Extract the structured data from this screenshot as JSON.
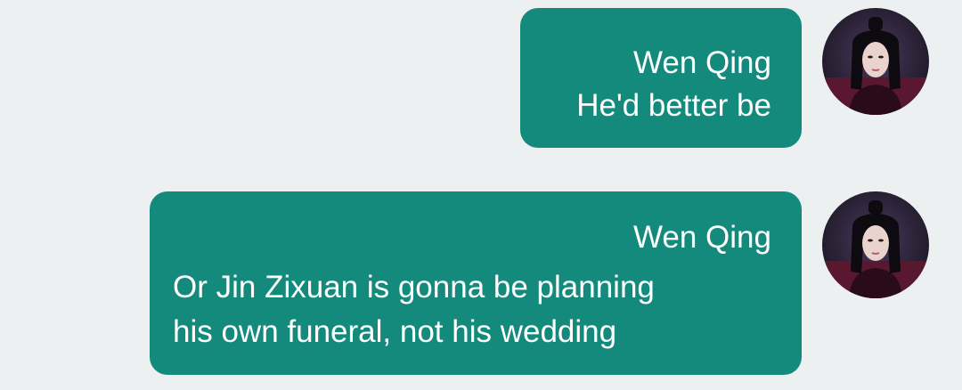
{
  "conversation": {
    "messages": [
      {
        "sender": "Wen Qing",
        "text": "He'd better be",
        "avatar_icon": "woman-portrait-avatar"
      },
      {
        "sender": "Wen Qing",
        "text": "Or Jin Zixuan is gonna be planning\nhis own funeral, not his wedding",
        "avatar_icon": "woman-portrait-avatar"
      }
    ]
  },
  "colors": {
    "background": "#ecf0f1",
    "bubble": "#148a7c",
    "text": "#ffffff"
  }
}
